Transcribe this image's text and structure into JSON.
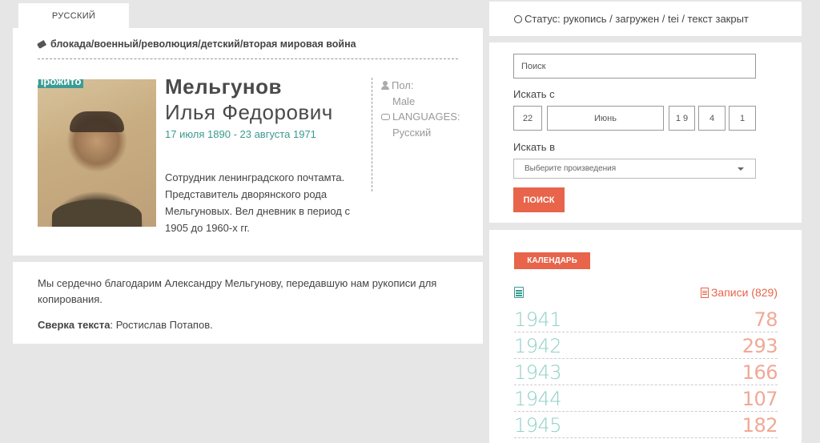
{
  "language_tab": "Русский",
  "diarist": {
    "tags": "блокада/военный/революция/детский/вторая мировая война",
    "badge": "Прожито",
    "surname": "Мельгунов",
    "given_names": "Илья Федорович",
    "dates": "17 июля 1890 - 23 августа 1971",
    "bio": "Сотрудник ленинградского почтамта. Представитель дворянского рода Мельгуновых. Вел дневник в период с 1905 до 1960-х гг.",
    "gender_label": "Пол:",
    "gender_value": "Male",
    "languages_label": "LANGUAGES:",
    "languages_value": "Русский"
  },
  "thanks": {
    "text": "Мы сердечно благодарим Александру Мельгунову, передавшую нам рукописи для копирования.",
    "proof_label": "Сверка текста",
    "proof_value": ": Ростислав Потапов."
  },
  "status": {
    "text": "Статус: рукопись / загружен / tei / текст закрыт"
  },
  "search": {
    "placeholder": "Поиск",
    "from_label": "Искать с",
    "day": "22",
    "month": "Июнь",
    "year_digits": [
      "1 9",
      "4",
      "1"
    ],
    "in_label": "Искать в",
    "select_value": "Выберите произведения",
    "button": "Поиск"
  },
  "calendar": {
    "button": "Календарь",
    "records_label": "Записи (829)",
    "rows": [
      {
        "year": "1941",
        "count": "78"
      },
      {
        "year": "1942",
        "count": "293"
      },
      {
        "year": "1943",
        "count": "166"
      },
      {
        "year": "1944",
        "count": "107"
      },
      {
        "year": "1945",
        "count": "182"
      }
    ]
  },
  "colors": {
    "accent_teal": "#3b9a90",
    "accent_orange": "#e8644a",
    "background": "#e6e6e6"
  }
}
